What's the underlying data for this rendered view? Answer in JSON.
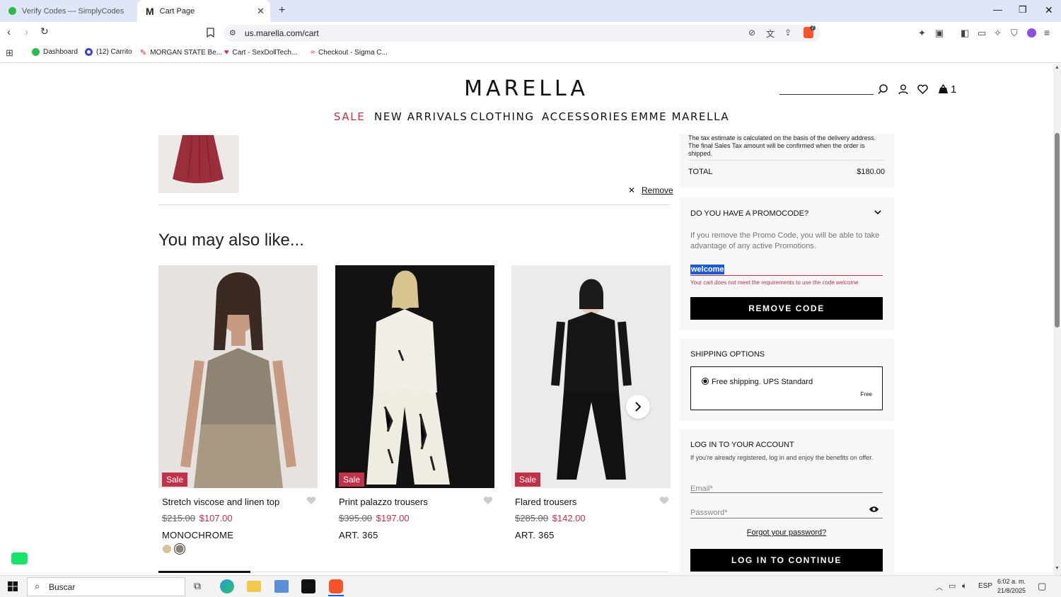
{
  "browser": {
    "tabs": [
      {
        "title": "Verify Codes — SimplyCodes"
      },
      {
        "title": "Cart Page"
      }
    ],
    "url": "us.marella.com/cart",
    "bookmarks": [
      {
        "label": "Dashboard"
      },
      {
        "label": "(12) Carrito"
      },
      {
        "label": "MORGAN STATE Be..."
      },
      {
        "label": "Cart - SexDollTech..."
      },
      {
        "label": "Checkout - Sigma C..."
      }
    ],
    "extension_badge": "7"
  },
  "site": {
    "logo": "MARELLA",
    "nav": [
      "SALE",
      "NEW ARRIVALS",
      "CLOTHING",
      "ACCESSORIES",
      "EMME MARELLA"
    ],
    "sale_color": "#c2314a",
    "cart_count": "1"
  },
  "cart": {
    "remove_label": "Remove"
  },
  "recommendations": {
    "heading": "You may also like...",
    "products": [
      {
        "badge": "Sale",
        "name": "Stretch viscose and linen top",
        "old_price": "$215.00",
        "new_price": "$107.00",
        "variant": "MONOCHROME"
      },
      {
        "badge": "Sale",
        "name": "Print palazzo trousers",
        "old_price": "$395.00",
        "new_price": "$197.00",
        "variant": "ART. 365"
      },
      {
        "badge": "Sale",
        "name": "Flared trousers",
        "old_price": "$285.00",
        "new_price": "$142.00",
        "variant": "ART. 365"
      }
    ]
  },
  "summary": {
    "tax_note": "The tax estimate is calculated on the basis of the delivery address. The final Sales Tax amount will be confirmed when the order is shipped.",
    "total_label": "TOTAL",
    "total_value": "$180.00"
  },
  "promo": {
    "title": "DO YOU HAVE A PROMOCODE?",
    "note": "If you remove the Promo Code, you will be able to take advantage of any active Promotions.",
    "code_value": "welcome",
    "error": "Your cart does not meet the requirements to use the code welcome",
    "button": "REMOVE CODE"
  },
  "shipping": {
    "title": "SHIPPING OPTIONS",
    "option_label": "Free shipping. UPS Standard",
    "option_price": "Free"
  },
  "login": {
    "title": "LOG IN TO YOUR ACCOUNT",
    "note": "If you're already registered, log in and enjoy the benefits on offer.",
    "email_placeholder": "Email*",
    "password_placeholder": "Password*",
    "forgot": "Forgot your password?",
    "button": "LOG IN TO CONTINUE"
  },
  "taskbar": {
    "search_placeholder": "Buscar",
    "lang": "ESP",
    "time": "6:02 a. m.",
    "date": "21/8/2025"
  }
}
